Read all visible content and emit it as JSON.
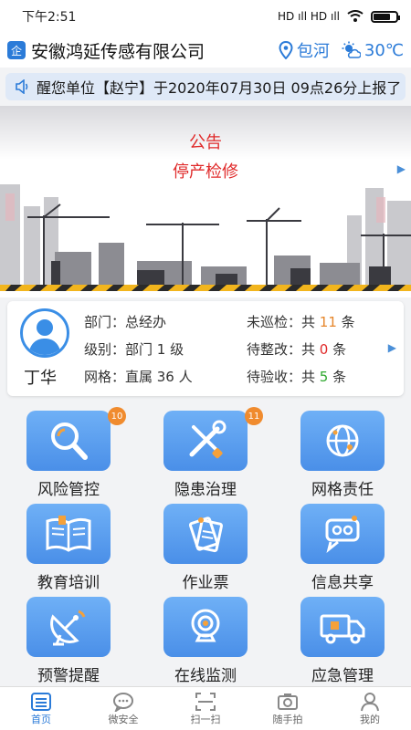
{
  "status_bar": {
    "time": "下午2:51",
    "signal": "HD ıll HD ıll"
  },
  "header": {
    "company": "安徽鸿延传感有限公司",
    "location": "包河",
    "temperature": "30℃"
  },
  "notice": {
    "text": "醒您单位【赵宁】于2020年07月30日 09点26分上报了"
  },
  "announcement": {
    "title": "公告",
    "subtitle": "停产检修"
  },
  "user": {
    "name": "丁华",
    "dept": "部门：总经办",
    "level": "级别：部门 1 级",
    "grid": "网格：直属 36 人",
    "uninspected_label": "未巡检：共 ",
    "uninspected_count": "11",
    "uninspected_unit": " 条",
    "pending_fix_label": "待整改：共 ",
    "pending_fix_count": "0",
    "pending_fix_unit": " 条",
    "pending_accept_label": "待验收：共 ",
    "pending_accept_count": "5",
    "pending_accept_unit": " 条"
  },
  "modules": [
    {
      "label": "风险管控",
      "badge": "10"
    },
    {
      "label": "隐患治理",
      "badge": "11"
    },
    {
      "label": "网格责任"
    },
    {
      "label": "教育培训"
    },
    {
      "label": "作业票"
    },
    {
      "label": "信息共享"
    },
    {
      "label": "预警提醒"
    },
    {
      "label": "在线监测"
    },
    {
      "label": "应急管理"
    }
  ],
  "tabs": [
    {
      "label": "首页"
    },
    {
      "label": "微安全"
    },
    {
      "label": "扫一扫"
    },
    {
      "label": "随手拍"
    },
    {
      "label": "我的"
    }
  ],
  "colors": {
    "accent": "#2b7bd8",
    "red": "#e02a2a",
    "badge": "#f08b2e"
  }
}
